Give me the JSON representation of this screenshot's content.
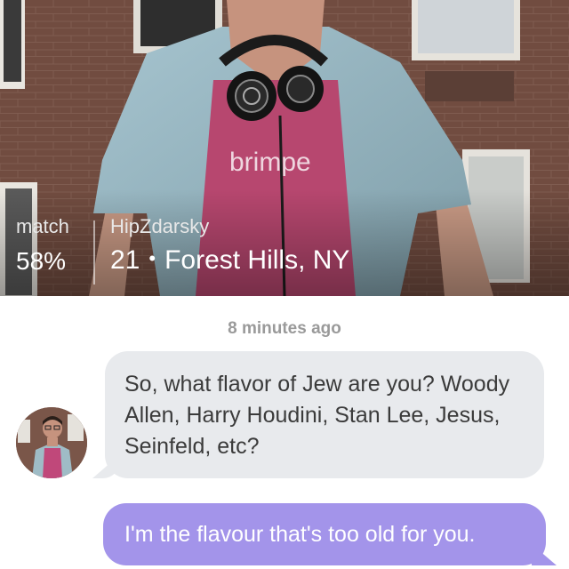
{
  "profile": {
    "match_label": "match",
    "match_value": "58%",
    "username": "HipZdarsky",
    "age": "21",
    "separator": "•",
    "location": "Forest Hills, NY",
    "shirt_text": "brimpe"
  },
  "chat": {
    "timestamp": "8 minutes ago",
    "messages": [
      {
        "from": "them",
        "text": "So, what flavor of Jew are you? Woody Allen, Harry Houdini, Stan Lee, Jesus, Seinfeld, etc?"
      },
      {
        "from": "me",
        "text": "I'm the flavour that's too old for you."
      }
    ]
  },
  "colors": {
    "incoming_bubble": "#e8eaed",
    "outgoing_bubble": "#a394ea",
    "timestamp": "#9a9a9a"
  }
}
